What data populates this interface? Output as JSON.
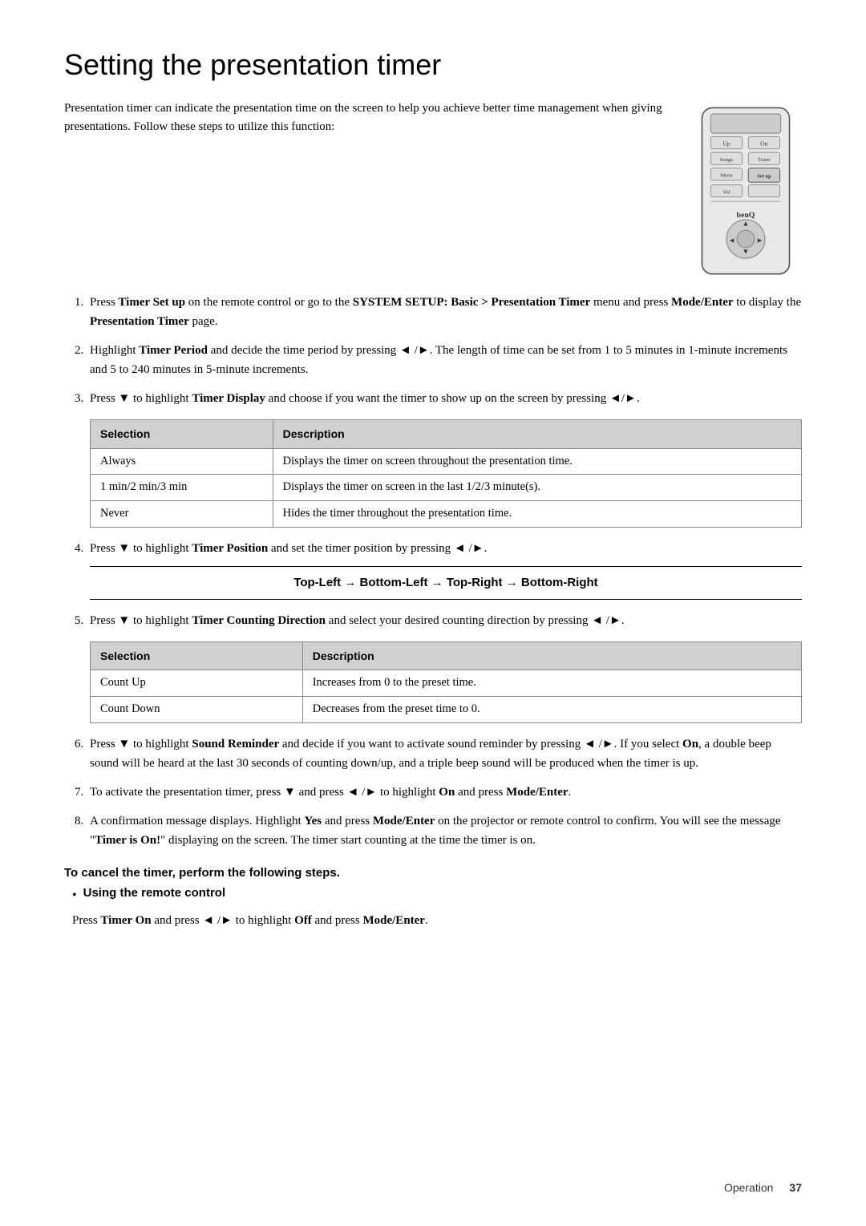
{
  "title": "Setting the presentation timer",
  "intro": "Presentation timer can indicate the presentation time on the screen to help you achieve better time management when giving presentations. Follow these steps to utilize this function:",
  "steps": [
    {
      "id": 1,
      "text_parts": [
        {
          "text": "Press ",
          "style": "normal"
        },
        {
          "text": "Timer Set up",
          "style": "bold"
        },
        {
          "text": " on the remote control or go to the ",
          "style": "normal"
        },
        {
          "text": "SYSTEM SETUP: Basic > Presentation Timer",
          "style": "bold"
        },
        {
          "text": " menu and press ",
          "style": "normal"
        },
        {
          "text": "Mode/Enter",
          "style": "bold"
        },
        {
          "text": " to display the ",
          "style": "normal"
        },
        {
          "text": "Presentation Timer",
          "style": "bold"
        },
        {
          "text": " page.",
          "style": "normal"
        }
      ]
    },
    {
      "id": 2,
      "text_parts": [
        {
          "text": "Highlight ",
          "style": "normal"
        },
        {
          "text": "Timer Period",
          "style": "bold"
        },
        {
          "text": " and decide the time period by pressing ◄ /►. The length of time can be set from 1 to 5 minutes in 1-minute increments and 5 to 240 minutes in 5-minute increments.",
          "style": "normal"
        }
      ]
    },
    {
      "id": 3,
      "text_parts": [
        {
          "text": "Press ▼ to highlight ",
          "style": "normal"
        },
        {
          "text": "Timer Display",
          "style": "bold"
        },
        {
          "text": " and choose if you want the timer to show up on the screen by pressing ◄/►.",
          "style": "normal"
        }
      ]
    },
    {
      "id": 4,
      "text_parts": [
        {
          "text": "Press ▼ to highlight ",
          "style": "normal"
        },
        {
          "text": "Timer Position",
          "style": "bold"
        },
        {
          "text": " and set the timer position by pressing ◄ /►.",
          "style": "normal"
        }
      ]
    },
    {
      "id": 5,
      "text_parts": [
        {
          "text": "Press ▼ to highlight ",
          "style": "normal"
        },
        {
          "text": "Timer Counting Direction",
          "style": "bold"
        },
        {
          "text": " and select your desired counting direction by pressing ◄ /►.",
          "style": "normal"
        }
      ]
    },
    {
      "id": 6,
      "text_parts": [
        {
          "text": "Press ▼ to highlight ",
          "style": "normal"
        },
        {
          "text": "Sound Reminder",
          "style": "bold"
        },
        {
          "text": " and decide if you want to activate sound reminder by pressing ◄ /►. If you select ",
          "style": "normal"
        },
        {
          "text": "On",
          "style": "bold"
        },
        {
          "text": ", a double beep sound will be heard at the last 30 seconds of counting down/up, and a triple beep sound will be produced when the timer is up.",
          "style": "normal"
        }
      ]
    },
    {
      "id": 7,
      "text_parts": [
        {
          "text": "To activate the presentation timer, press ▼ and press ◄ /► to highlight ",
          "style": "normal"
        },
        {
          "text": "On",
          "style": "bold"
        },
        {
          "text": " and press ",
          "style": "normal"
        },
        {
          "text": "Mode/Enter",
          "style": "bold"
        },
        {
          "text": ".",
          "style": "normal"
        }
      ]
    },
    {
      "id": 8,
      "text_parts": [
        {
          "text": "A confirmation message displays. Highlight ",
          "style": "normal"
        },
        {
          "text": "Yes",
          "style": "bold"
        },
        {
          "text": " and press ",
          "style": "normal"
        },
        {
          "text": "Mode/Enter",
          "style": "bold"
        },
        {
          "text": " on the projector or remote control to confirm. You will see the message \"",
          "style": "normal"
        },
        {
          "text": "Timer is On!",
          "style": "bold"
        },
        {
          "text": "\" displaying on the screen. The timer start counting at the time the timer is on.",
          "style": "normal"
        }
      ]
    }
  ],
  "table1": {
    "headers": [
      "Selection",
      "Description"
    ],
    "rows": [
      [
        "Always",
        "Displays the timer on screen throughout the presentation time."
      ],
      [
        "1 min/2 min/3 min",
        "Displays the timer on screen in the last 1/2/3 minute(s)."
      ],
      [
        "Never",
        "Hides the timer throughout the presentation time."
      ]
    ]
  },
  "direction_line": "Top-Left → Bottom-Left → Top-Right → Bottom-Right",
  "table2": {
    "headers": [
      "Selection",
      "Description"
    ],
    "rows": [
      [
        "Count Up",
        "Increases from 0 to the preset time."
      ],
      [
        "Count Down",
        "Decreases from the preset time to 0."
      ]
    ]
  },
  "cancel_heading": "To cancel the timer, perform the following steps.",
  "using_remote_label": "Using the remote control",
  "cancel_instruction_parts": [
    {
      "text": "Press ",
      "style": "normal"
    },
    {
      "text": "Timer On",
      "style": "bold"
    },
    {
      "text": " and press ◄ /► to highlight ",
      "style": "normal"
    },
    {
      "text": "Off",
      "style": "bold"
    },
    {
      "text": " and press ",
      "style": "normal"
    },
    {
      "text": "Mode/Enter",
      "style": "bold"
    },
    {
      "text": ".",
      "style": "normal"
    }
  ],
  "footer": {
    "section": "Operation",
    "page": "37"
  }
}
